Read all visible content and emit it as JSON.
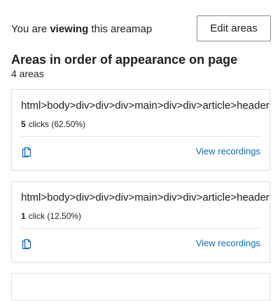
{
  "header": {
    "viewing_prefix": "You are ",
    "viewing_bold": "viewing",
    "viewing_suffix": " this areamap",
    "edit_button": "Edit areas"
  },
  "section": {
    "title": "Areas in order of appearance on page",
    "count": "4 areas"
  },
  "areas": [
    {
      "path": "html>body>div>div>div>main>div>div>article>header",
      "clicks_num": "5",
      "clicks_text": "clicks (62.50%)",
      "copy_icon": "copy-icon",
      "recordings_label": "View recordings"
    },
    {
      "path": "html>body>div>div>div>main>div>div>article>header",
      "clicks_num": "1",
      "clicks_text": "click (12.50%)",
      "copy_icon": "copy-icon",
      "recordings_label": "View recordings"
    }
  ],
  "colors": {
    "link": "#0f6cbd",
    "border": "#e1e1e1",
    "text": "#1f1f1f"
  }
}
